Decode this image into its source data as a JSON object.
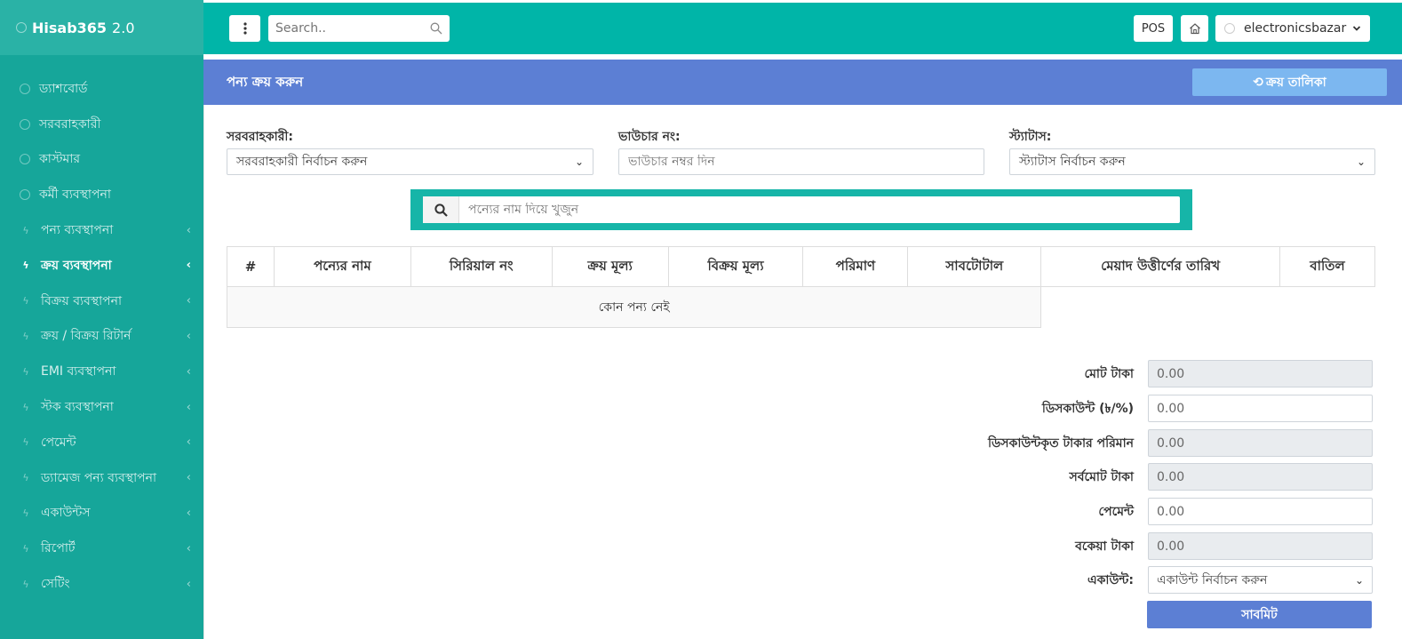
{
  "brand": {
    "name": "Hisab365",
    "version": "2.0"
  },
  "sidebar": {
    "items": [
      {
        "label": "ড্যাশবোর্ড",
        "icon": "circle-icon",
        "chevron": ""
      },
      {
        "label": "সরবরাহকারী",
        "icon": "circle-icon",
        "chevron": ""
      },
      {
        "label": "কাস্টমার",
        "icon": "circle-icon",
        "chevron": ""
      },
      {
        "label": "কর্মী ব্যবস্থাপনা",
        "icon": "circle-icon",
        "chevron": ""
      },
      {
        "label": "পন্য ব্যবস্থাপনা",
        "icon": "bolt-icon",
        "chevron": "‹"
      },
      {
        "label": "ক্রয় ব্যবস্থাপনা",
        "icon": "bolt-icon",
        "chevron": "‹",
        "active": true
      },
      {
        "label": "বিক্রয় ব্যবস্থাপনা",
        "icon": "bolt-icon",
        "chevron": "‹"
      },
      {
        "label": "ক্রয় / বিক্রয় রিটার্ন",
        "icon": "bolt-icon",
        "chevron": "‹"
      },
      {
        "label": "EMI ব্যবস্থাপনা",
        "icon": "bolt-icon",
        "chevron": "‹"
      },
      {
        "label": "স্টক ব্যবস্থাপনা",
        "icon": "bolt-icon",
        "chevron": "‹"
      },
      {
        "label": "পেমেন্ট",
        "icon": "bolt-icon",
        "chevron": "‹"
      },
      {
        "label": "ড্যামেজ পন্য ব্যবস্থাপনা",
        "icon": "bolt-icon",
        "chevron": "‹"
      },
      {
        "label": "একাউন্টস",
        "icon": "bolt-icon",
        "chevron": "‹"
      },
      {
        "label": "রিপোর্ট",
        "icon": "bolt-icon",
        "chevron": "‹"
      },
      {
        "label": "সেটিং",
        "icon": "bolt-icon",
        "chevron": "‹"
      }
    ]
  },
  "topbar": {
    "search_placeholder": "Search..",
    "pos_label": "POS",
    "user_name": "electronicsbazar"
  },
  "page": {
    "title": "পন্য ক্রয় করুন",
    "list_button": "ক্রয় তালিকা"
  },
  "form": {
    "supplier_label": "সরবরাহকারী:",
    "supplier_value": "সরবরাহকারী নির্বাচন করুন",
    "voucher_label": "ভাউচার নং:",
    "voucher_placeholder": "ভাউচার নম্বর দিন",
    "status_label": "স্ট্যাটাস:",
    "status_value": "স্ট্যাটাস নির্বাচন করুন",
    "product_search_placeholder": "পন্যের নাম দিয়ে খুজুন"
  },
  "table": {
    "columns": [
      "#",
      "পন্যের নাম",
      "সিরিয়াল নং",
      "ক্রয় মূল্য",
      "বিক্রয় মূল্য",
      "পরিমাণ",
      "সাবটোটাল",
      "মেয়াদ উত্তীর্ণের তারিখ",
      "বাতিল"
    ],
    "empty_text": "কোন পন্য নেই"
  },
  "summary": {
    "total_label": "মোট টাকা",
    "total_value": "0.00",
    "discount_label": "ডিসকাউন্ট (৳/%)",
    "discount_value": "0.00",
    "discount_amount_label": "ডিসকাউন্টকৃত টাকার পরিমান",
    "discount_amount_value": "0.00",
    "grand_total_label": "সর্বমোট টাকা",
    "grand_total_value": "0.00",
    "payment_label": "পেমেন্ট",
    "payment_value": "0.00",
    "due_label": "বকেয়া টাকা",
    "due_value": "0.00",
    "account_label": "একাউন্ট:",
    "account_value": "একাউন্ট নির্বাচন করুন",
    "submit_label": "সাবমিট"
  },
  "colors": {
    "sidebar": "#16a69a",
    "topbar": "#00b5a8",
    "header": "#5c7fd4",
    "accent_button": "#7cb7f0"
  }
}
